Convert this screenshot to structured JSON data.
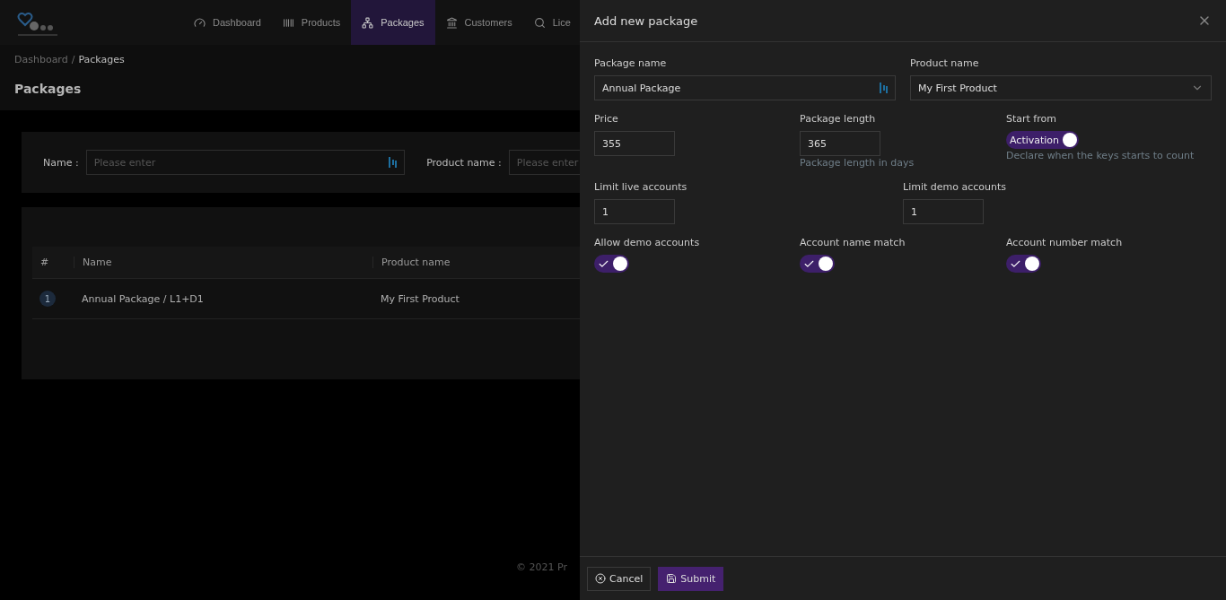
{
  "nav": {
    "items": [
      {
        "label": "Dashboard",
        "selected": false
      },
      {
        "label": "Products",
        "selected": false
      },
      {
        "label": "Packages",
        "selected": true
      },
      {
        "label": "Customers",
        "selected": false
      },
      {
        "label": "Lice",
        "selected": false
      }
    ]
  },
  "breadcrumb": [
    {
      "label": "Dashboard",
      "current": false
    },
    {
      "label": "Packages",
      "current": true
    }
  ],
  "breadcrumb_separator": "/",
  "page_title": "Packages",
  "filters": [
    {
      "label": "Name :",
      "placeholder": "Please enter"
    },
    {
      "label": "Product name :",
      "placeholder": "Please enter"
    }
  ],
  "table": {
    "columns": [
      "#",
      "Name",
      "Product name"
    ],
    "rows": [
      {
        "index": "1",
        "name": "Annual Package / L1+D1",
        "product": "My First Product"
      }
    ]
  },
  "footer": "© 2021 Pr",
  "drawer": {
    "title": "Add new package",
    "rows": [
      {
        "fields": [
          {
            "kind": "text",
            "label": "Package name",
            "value": "Annual Package"
          },
          {
            "kind": "select",
            "label": "Product name",
            "value": "My First Product"
          }
        ]
      },
      {
        "fields": [
          {
            "kind": "number",
            "label": "Price",
            "value": "355"
          },
          {
            "kind": "number",
            "label": "Package length",
            "value": "365",
            "help": "Package length in days"
          },
          {
            "kind": "switch",
            "label": "Start from",
            "on": true,
            "text": "Activation",
            "help": "Declare when the keys starts to count"
          }
        ]
      },
      {
        "fields": [
          {
            "kind": "number",
            "label": "Limit live accounts",
            "value": "1"
          },
          {
            "kind": "number",
            "label": "Limit demo accounts",
            "value": "1"
          }
        ]
      },
      {
        "fields": [
          {
            "kind": "switch",
            "label": "Allow demo accounts",
            "on": true
          },
          {
            "kind": "switch",
            "label": "Account name match",
            "on": true
          },
          {
            "kind": "switch",
            "label": "Account number match",
            "on": true
          }
        ]
      }
    ],
    "buttons": [
      {
        "kind": "cancel",
        "label": "Cancel"
      },
      {
        "kind": "submit",
        "label": "Submit"
      }
    ]
  }
}
